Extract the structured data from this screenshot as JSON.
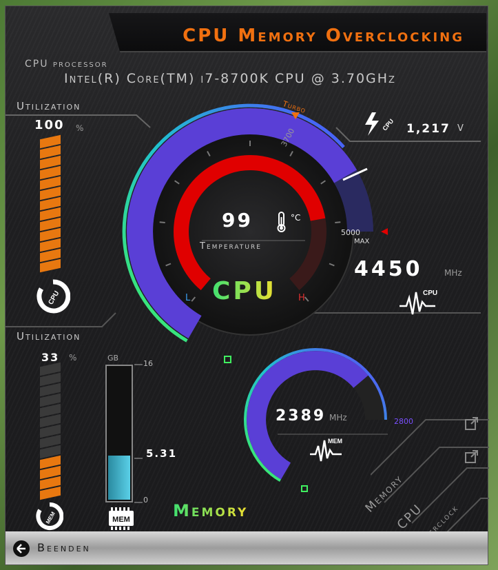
{
  "window": {
    "title": "CPU Memory Overclocking"
  },
  "processor": {
    "label": "CPU processor",
    "name": "Intel(R) Core(TM) i7-8700K CPU @ 3.70GHz"
  },
  "cpu": {
    "utilization_label": "Utilization",
    "utilization_value": "100",
    "utilization_unit": "%",
    "utilization_fraction": 1.0,
    "voltage_value": "1,217",
    "voltage_unit": "V",
    "turbo_label": "Turbo",
    "turbo_value": "3700",
    "max_value": "5000",
    "max_label": "MAX",
    "temperature_value": "99",
    "temperature_unit": "°C",
    "temperature_label": "Temperature",
    "temperature_low": "L",
    "temperature_high": "H",
    "frequency_value": "4450",
    "frequency_unit": "MHz",
    "icon_caption": "CPU",
    "gauge_label": "CPU"
  },
  "memory": {
    "utilization_label": "Utilization",
    "utilization_value": "33",
    "utilization_unit": "%",
    "utilization_fraction": 0.33,
    "usage_unit": "GB",
    "usage_max": "16",
    "usage_value": "5.31",
    "usage_min": "0",
    "usage_fraction": 0.33,
    "chip_label": "MEM",
    "frequency_value": "2389",
    "frequency_unit": "MHz",
    "frequency_max": "2800",
    "icon_caption": "MEM",
    "gauge_label": "Memory",
    "badge_label": "MEM"
  },
  "cpu_badge_label": "CPU",
  "tabs": [
    {
      "label": "Memory"
    },
    {
      "label": "CPU"
    },
    {
      "label": "Overclock"
    }
  ],
  "footer": {
    "quit_label": "Beenden"
  },
  "colors": {
    "accent": "#f07010",
    "gauge_fill": "#5a3fd6",
    "temp_red": "#e00000",
    "cpu_label_gradient_start": "#40e070",
    "cpu_label_gradient_end": "#f0e030",
    "bar_orange": "#e87810",
    "mem_bar_blue": "#46b8d0"
  },
  "icons": {
    "voltage": "lightning-bolt-icon",
    "waveform": "waveform-icon",
    "thermometer": "thermometer-icon",
    "chip": "memory-chip-icon",
    "external": "external-link-icon",
    "quit": "back-arrow-icon"
  }
}
